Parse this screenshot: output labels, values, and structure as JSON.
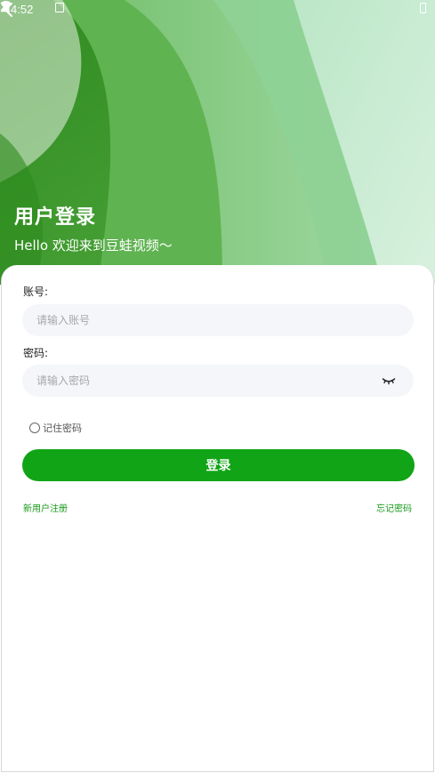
{
  "status_bar": {
    "time": "4:52",
    "icons": [
      "download-icon",
      "notification-icon",
      "wifi-icon",
      "signal-icon",
      "battery-icon"
    ]
  },
  "header": {
    "back_icon": "chevron-left-icon",
    "title": "用户登录",
    "subtitle": "Hello 欢迎来到豆蛙视频～"
  },
  "form": {
    "account_label": "账号:",
    "account_placeholder": "请输入账号",
    "account_value": "",
    "password_label": "密码:",
    "password_placeholder": "请输入密码",
    "password_value": "",
    "password_toggle_icon": "eye-closed-icon",
    "remember_label": "记住密码",
    "remember_checked": false,
    "login_label": "登录"
  },
  "links": {
    "register": "新用户注册",
    "forgot_password": "忘记密码"
  },
  "colors": {
    "primary": "#11a416",
    "link": "#17991a",
    "input_bg": "#f5f6fa"
  }
}
